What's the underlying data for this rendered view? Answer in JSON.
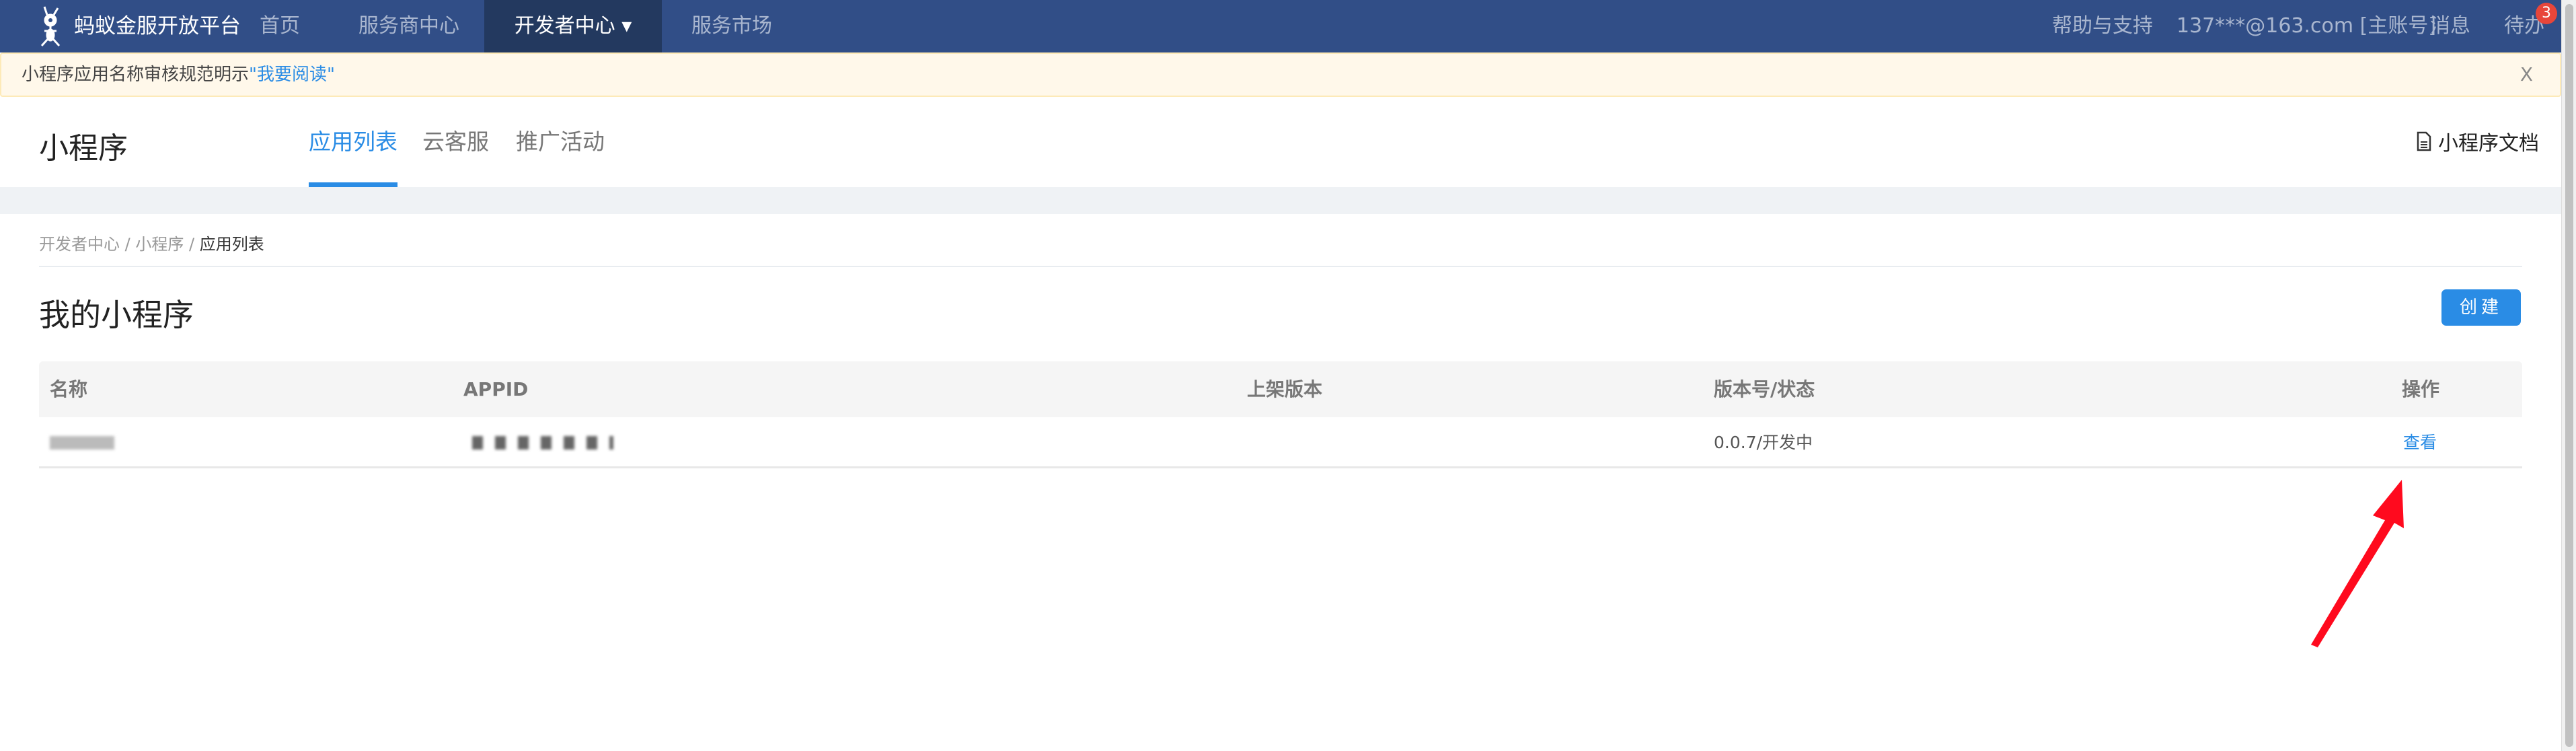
{
  "topnav": {
    "logo_text": "蚂蚁金服开放平台",
    "items": [
      {
        "label": "首页"
      },
      {
        "label": "服务商中心"
      },
      {
        "label": "开发者中心 ▾",
        "active": true
      },
      {
        "label": "服务市场"
      }
    ],
    "right": {
      "help": "帮助与支持",
      "account": "137***@163.com [主账号]",
      "messages": "消息",
      "todo": "待办",
      "todo_badge": "3"
    }
  },
  "notice": {
    "text": "小程序应用名称审核规范明示",
    "link": "\"我要阅读\"",
    "close": "X"
  },
  "header": {
    "title": "小程序",
    "tabs": [
      {
        "label": "应用列表",
        "active": true
      },
      {
        "label": "云客服"
      },
      {
        "label": "推广活动"
      }
    ],
    "doc_link": "小程序文档"
  },
  "breadcrumb": [
    "开发者中心",
    "小程序",
    "应用列表"
  ],
  "breadcrumb_sep": "/",
  "page_title": "我的小程序",
  "create_button": "创建",
  "table": {
    "columns": [
      "名称",
      "APPID",
      "上架版本",
      "版本号/状态",
      "操作"
    ],
    "rows": [
      {
        "version_status": "0.0.7/开发中",
        "action": "查看"
      }
    ]
  },
  "colors": {
    "nav": "#314e87",
    "accent": "#2a8ce5",
    "arrow": "#ff0a1e"
  }
}
